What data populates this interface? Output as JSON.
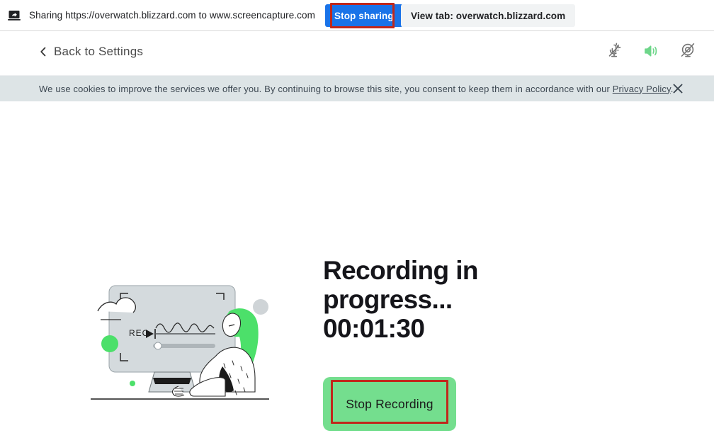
{
  "share_bar": {
    "icon": "screen-share-icon",
    "message": "Sharing https://overwatch.blizzard.com to www.screencapture.com",
    "stop_sharing_label": "Stop sharing",
    "view_tab_label": "View tab: overwatch.blizzard.com",
    "stop_sharing_bg": "#1a73e8",
    "annotation_color": "#c0281b"
  },
  "header": {
    "back_label": "Back to Settings",
    "icons": [
      {
        "name": "microphone-off-icon",
        "state": "muted",
        "color": "#707070"
      },
      {
        "name": "speaker-on-icon",
        "state": "on",
        "color": "#6ed68a"
      },
      {
        "name": "webcam-off-icon",
        "state": "off",
        "color": "#707070"
      }
    ]
  },
  "cookie_banner": {
    "text_before": "We use cookies to improve the services we offer you. By continuing to browse this site, you consent to keep them in accordance with our ",
    "link_label": "Privacy Policy",
    "text_after": ".",
    "close_icon": "close-icon",
    "background": "#dde4e6"
  },
  "main": {
    "status_line1": "Recording in",
    "status_line2": "progress...",
    "timer": "00:01:30",
    "stop_recording_label": "Stop Recording",
    "button_color": "#74de8e",
    "illustration": {
      "name": "recording-illustration",
      "screen_label": "REC",
      "accent_color": "#4ce06a",
      "screen_color": "#d4dadd"
    }
  }
}
